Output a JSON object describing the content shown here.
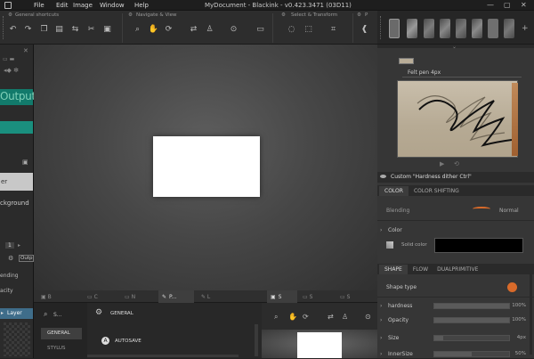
{
  "menu": {
    "file": "File",
    "edit": "Edit",
    "image": "Image",
    "window": "Window",
    "help": "Help"
  },
  "title": "MyDocument - Blackink - v0.423.3471 (03D11)",
  "toolbar": {
    "general": "General shortcuts",
    "navigate": "Navigate & View",
    "select": "Select & Transform",
    "p": "P"
  },
  "brush": {
    "preset": "Felt pen 4px",
    "custom": "Custom \"Hardness dither Ctrl\""
  },
  "left": {
    "output": "Output",
    "layer_r": "er",
    "background": "ckground",
    "outp": "Outp",
    "blending": "ending",
    "opacity": "acity",
    "layer": "Layer",
    "num": "1"
  },
  "color_tabs": {
    "color": "COLOR",
    "shifting": "COLOR SHIFTING"
  },
  "blending": {
    "label": "Blending",
    "value": "Normal"
  },
  "color": {
    "label": "Color",
    "solid": "Solid color",
    "value": "#000000"
  },
  "shape_tabs": {
    "shape": "SHAPE",
    "flow": "FLOW",
    "dual": "DUALPRIMITIVE"
  },
  "shape_type": "Shape type",
  "params": [
    {
      "name": "hardness",
      "value": "100%",
      "level": 1.0
    },
    {
      "name": "Opacity",
      "value": "100%",
      "level": 1.0
    },
    {
      "name": "Size",
      "value": "4px",
      "level": 0.12
    },
    {
      "name": "InnerSize",
      "value": "50%",
      "level": 0.5
    }
  ],
  "bottom": {
    "tab_p": "P...",
    "tab_s": "S",
    "search": "S...",
    "general": "GENERAL",
    "stylus": "STYLUS",
    "autosave": "AUTOSAVE"
  },
  "colors": {
    "accent_teal": "#1a8f7e",
    "orange": "#d86a2a"
  }
}
